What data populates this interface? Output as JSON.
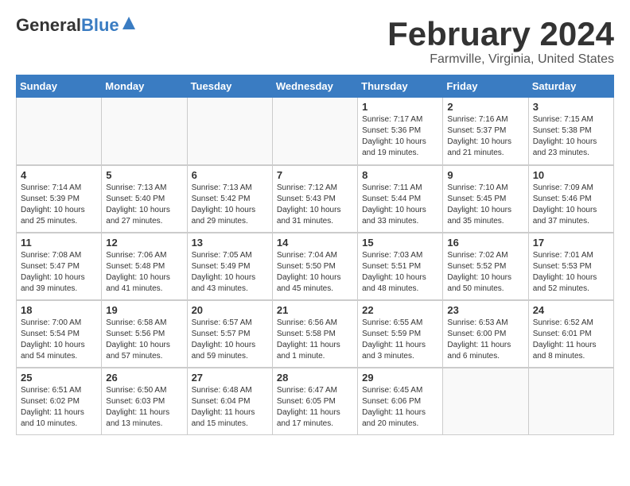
{
  "header": {
    "logo_general": "General",
    "logo_blue": "Blue",
    "month_title": "February 2024",
    "location": "Farmville, Virginia, United States"
  },
  "days_of_week": [
    "Sunday",
    "Monday",
    "Tuesday",
    "Wednesday",
    "Thursday",
    "Friday",
    "Saturday"
  ],
  "weeks": [
    [
      {
        "num": "",
        "sunrise": "",
        "sunset": "",
        "daylight": "",
        "empty": true
      },
      {
        "num": "",
        "sunrise": "",
        "sunset": "",
        "daylight": "",
        "empty": true
      },
      {
        "num": "",
        "sunrise": "",
        "sunset": "",
        "daylight": "",
        "empty": true
      },
      {
        "num": "",
        "sunrise": "",
        "sunset": "",
        "daylight": "",
        "empty": true
      },
      {
        "num": "1",
        "sunrise": "Sunrise: 7:17 AM",
        "sunset": "Sunset: 5:36 PM",
        "daylight": "Daylight: 10 hours and 19 minutes.",
        "empty": false
      },
      {
        "num": "2",
        "sunrise": "Sunrise: 7:16 AM",
        "sunset": "Sunset: 5:37 PM",
        "daylight": "Daylight: 10 hours and 21 minutes.",
        "empty": false
      },
      {
        "num": "3",
        "sunrise": "Sunrise: 7:15 AM",
        "sunset": "Sunset: 5:38 PM",
        "daylight": "Daylight: 10 hours and 23 minutes.",
        "empty": false
      }
    ],
    [
      {
        "num": "4",
        "sunrise": "Sunrise: 7:14 AM",
        "sunset": "Sunset: 5:39 PM",
        "daylight": "Daylight: 10 hours and 25 minutes.",
        "empty": false
      },
      {
        "num": "5",
        "sunrise": "Sunrise: 7:13 AM",
        "sunset": "Sunset: 5:40 PM",
        "daylight": "Daylight: 10 hours and 27 minutes.",
        "empty": false
      },
      {
        "num": "6",
        "sunrise": "Sunrise: 7:13 AM",
        "sunset": "Sunset: 5:42 PM",
        "daylight": "Daylight: 10 hours and 29 minutes.",
        "empty": false
      },
      {
        "num": "7",
        "sunrise": "Sunrise: 7:12 AM",
        "sunset": "Sunset: 5:43 PM",
        "daylight": "Daylight: 10 hours and 31 minutes.",
        "empty": false
      },
      {
        "num": "8",
        "sunrise": "Sunrise: 7:11 AM",
        "sunset": "Sunset: 5:44 PM",
        "daylight": "Daylight: 10 hours and 33 minutes.",
        "empty": false
      },
      {
        "num": "9",
        "sunrise": "Sunrise: 7:10 AM",
        "sunset": "Sunset: 5:45 PM",
        "daylight": "Daylight: 10 hours and 35 minutes.",
        "empty": false
      },
      {
        "num": "10",
        "sunrise": "Sunrise: 7:09 AM",
        "sunset": "Sunset: 5:46 PM",
        "daylight": "Daylight: 10 hours and 37 minutes.",
        "empty": false
      }
    ],
    [
      {
        "num": "11",
        "sunrise": "Sunrise: 7:08 AM",
        "sunset": "Sunset: 5:47 PM",
        "daylight": "Daylight: 10 hours and 39 minutes.",
        "empty": false
      },
      {
        "num": "12",
        "sunrise": "Sunrise: 7:06 AM",
        "sunset": "Sunset: 5:48 PM",
        "daylight": "Daylight: 10 hours and 41 minutes.",
        "empty": false
      },
      {
        "num": "13",
        "sunrise": "Sunrise: 7:05 AM",
        "sunset": "Sunset: 5:49 PM",
        "daylight": "Daylight: 10 hours and 43 minutes.",
        "empty": false
      },
      {
        "num": "14",
        "sunrise": "Sunrise: 7:04 AM",
        "sunset": "Sunset: 5:50 PM",
        "daylight": "Daylight: 10 hours and 45 minutes.",
        "empty": false
      },
      {
        "num": "15",
        "sunrise": "Sunrise: 7:03 AM",
        "sunset": "Sunset: 5:51 PM",
        "daylight": "Daylight: 10 hours and 48 minutes.",
        "empty": false
      },
      {
        "num": "16",
        "sunrise": "Sunrise: 7:02 AM",
        "sunset": "Sunset: 5:52 PM",
        "daylight": "Daylight: 10 hours and 50 minutes.",
        "empty": false
      },
      {
        "num": "17",
        "sunrise": "Sunrise: 7:01 AM",
        "sunset": "Sunset: 5:53 PM",
        "daylight": "Daylight: 10 hours and 52 minutes.",
        "empty": false
      }
    ],
    [
      {
        "num": "18",
        "sunrise": "Sunrise: 7:00 AM",
        "sunset": "Sunset: 5:54 PM",
        "daylight": "Daylight: 10 hours and 54 minutes.",
        "empty": false
      },
      {
        "num": "19",
        "sunrise": "Sunrise: 6:58 AM",
        "sunset": "Sunset: 5:56 PM",
        "daylight": "Daylight: 10 hours and 57 minutes.",
        "empty": false
      },
      {
        "num": "20",
        "sunrise": "Sunrise: 6:57 AM",
        "sunset": "Sunset: 5:57 PM",
        "daylight": "Daylight: 10 hours and 59 minutes.",
        "empty": false
      },
      {
        "num": "21",
        "sunrise": "Sunrise: 6:56 AM",
        "sunset": "Sunset: 5:58 PM",
        "daylight": "Daylight: 11 hours and 1 minute.",
        "empty": false
      },
      {
        "num": "22",
        "sunrise": "Sunrise: 6:55 AM",
        "sunset": "Sunset: 5:59 PM",
        "daylight": "Daylight: 11 hours and 3 minutes.",
        "empty": false
      },
      {
        "num": "23",
        "sunrise": "Sunrise: 6:53 AM",
        "sunset": "Sunset: 6:00 PM",
        "daylight": "Daylight: 11 hours and 6 minutes.",
        "empty": false
      },
      {
        "num": "24",
        "sunrise": "Sunrise: 6:52 AM",
        "sunset": "Sunset: 6:01 PM",
        "daylight": "Daylight: 11 hours and 8 minutes.",
        "empty": false
      }
    ],
    [
      {
        "num": "25",
        "sunrise": "Sunrise: 6:51 AM",
        "sunset": "Sunset: 6:02 PM",
        "daylight": "Daylight: 11 hours and 10 minutes.",
        "empty": false
      },
      {
        "num": "26",
        "sunrise": "Sunrise: 6:50 AM",
        "sunset": "Sunset: 6:03 PM",
        "daylight": "Daylight: 11 hours and 13 minutes.",
        "empty": false
      },
      {
        "num": "27",
        "sunrise": "Sunrise: 6:48 AM",
        "sunset": "Sunset: 6:04 PM",
        "daylight": "Daylight: 11 hours and 15 minutes.",
        "empty": false
      },
      {
        "num": "28",
        "sunrise": "Sunrise: 6:47 AM",
        "sunset": "Sunset: 6:05 PM",
        "daylight": "Daylight: 11 hours and 17 minutes.",
        "empty": false
      },
      {
        "num": "29",
        "sunrise": "Sunrise: 6:45 AM",
        "sunset": "Sunset: 6:06 PM",
        "daylight": "Daylight: 11 hours and 20 minutes.",
        "empty": false
      },
      {
        "num": "",
        "sunrise": "",
        "sunset": "",
        "daylight": "",
        "empty": true
      },
      {
        "num": "",
        "sunrise": "",
        "sunset": "",
        "daylight": "",
        "empty": true
      }
    ]
  ]
}
